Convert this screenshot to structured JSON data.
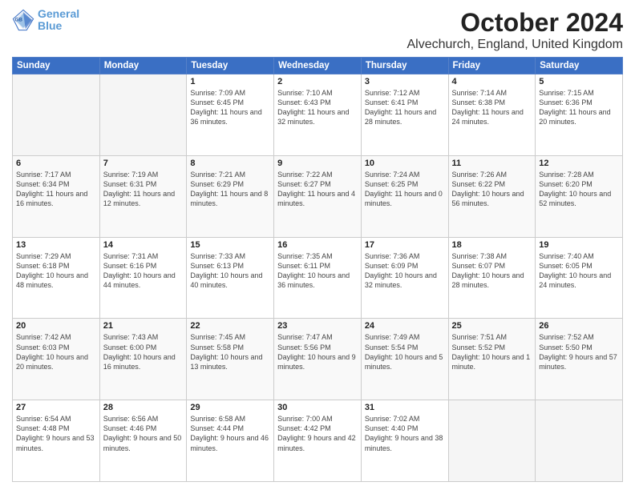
{
  "header": {
    "logo_line1": "General",
    "logo_line2": "Blue",
    "month": "October 2024",
    "location": "Alvechurch, England, United Kingdom"
  },
  "weekdays": [
    "Sunday",
    "Monday",
    "Tuesday",
    "Wednesday",
    "Thursday",
    "Friday",
    "Saturday"
  ],
  "weeks": [
    [
      {
        "day": "",
        "sunrise": "",
        "sunset": "",
        "daylight": "",
        "empty": true
      },
      {
        "day": "",
        "sunrise": "",
        "sunset": "",
        "daylight": "",
        "empty": true
      },
      {
        "day": "1",
        "sunrise": "Sunrise: 7:09 AM",
        "sunset": "Sunset: 6:45 PM",
        "daylight": "Daylight: 11 hours and 36 minutes."
      },
      {
        "day": "2",
        "sunrise": "Sunrise: 7:10 AM",
        "sunset": "Sunset: 6:43 PM",
        "daylight": "Daylight: 11 hours and 32 minutes."
      },
      {
        "day": "3",
        "sunrise": "Sunrise: 7:12 AM",
        "sunset": "Sunset: 6:41 PM",
        "daylight": "Daylight: 11 hours and 28 minutes."
      },
      {
        "day": "4",
        "sunrise": "Sunrise: 7:14 AM",
        "sunset": "Sunset: 6:38 PM",
        "daylight": "Daylight: 11 hours and 24 minutes."
      },
      {
        "day": "5",
        "sunrise": "Sunrise: 7:15 AM",
        "sunset": "Sunset: 6:36 PM",
        "daylight": "Daylight: 11 hours and 20 minutes."
      }
    ],
    [
      {
        "day": "6",
        "sunrise": "Sunrise: 7:17 AM",
        "sunset": "Sunset: 6:34 PM",
        "daylight": "Daylight: 11 hours and 16 minutes."
      },
      {
        "day": "7",
        "sunrise": "Sunrise: 7:19 AM",
        "sunset": "Sunset: 6:31 PM",
        "daylight": "Daylight: 11 hours and 12 minutes."
      },
      {
        "day": "8",
        "sunrise": "Sunrise: 7:21 AM",
        "sunset": "Sunset: 6:29 PM",
        "daylight": "Daylight: 11 hours and 8 minutes."
      },
      {
        "day": "9",
        "sunrise": "Sunrise: 7:22 AM",
        "sunset": "Sunset: 6:27 PM",
        "daylight": "Daylight: 11 hours and 4 minutes."
      },
      {
        "day": "10",
        "sunrise": "Sunrise: 7:24 AM",
        "sunset": "Sunset: 6:25 PM",
        "daylight": "Daylight: 11 hours and 0 minutes."
      },
      {
        "day": "11",
        "sunrise": "Sunrise: 7:26 AM",
        "sunset": "Sunset: 6:22 PM",
        "daylight": "Daylight: 10 hours and 56 minutes."
      },
      {
        "day": "12",
        "sunrise": "Sunrise: 7:28 AM",
        "sunset": "Sunset: 6:20 PM",
        "daylight": "Daylight: 10 hours and 52 minutes."
      }
    ],
    [
      {
        "day": "13",
        "sunrise": "Sunrise: 7:29 AM",
        "sunset": "Sunset: 6:18 PM",
        "daylight": "Daylight: 10 hours and 48 minutes."
      },
      {
        "day": "14",
        "sunrise": "Sunrise: 7:31 AM",
        "sunset": "Sunset: 6:16 PM",
        "daylight": "Daylight: 10 hours and 44 minutes."
      },
      {
        "day": "15",
        "sunrise": "Sunrise: 7:33 AM",
        "sunset": "Sunset: 6:13 PM",
        "daylight": "Daylight: 10 hours and 40 minutes."
      },
      {
        "day": "16",
        "sunrise": "Sunrise: 7:35 AM",
        "sunset": "Sunset: 6:11 PM",
        "daylight": "Daylight: 10 hours and 36 minutes."
      },
      {
        "day": "17",
        "sunrise": "Sunrise: 7:36 AM",
        "sunset": "Sunset: 6:09 PM",
        "daylight": "Daylight: 10 hours and 32 minutes."
      },
      {
        "day": "18",
        "sunrise": "Sunrise: 7:38 AM",
        "sunset": "Sunset: 6:07 PM",
        "daylight": "Daylight: 10 hours and 28 minutes."
      },
      {
        "day": "19",
        "sunrise": "Sunrise: 7:40 AM",
        "sunset": "Sunset: 6:05 PM",
        "daylight": "Daylight: 10 hours and 24 minutes."
      }
    ],
    [
      {
        "day": "20",
        "sunrise": "Sunrise: 7:42 AM",
        "sunset": "Sunset: 6:03 PM",
        "daylight": "Daylight: 10 hours and 20 minutes."
      },
      {
        "day": "21",
        "sunrise": "Sunrise: 7:43 AM",
        "sunset": "Sunset: 6:00 PM",
        "daylight": "Daylight: 10 hours and 16 minutes."
      },
      {
        "day": "22",
        "sunrise": "Sunrise: 7:45 AM",
        "sunset": "Sunset: 5:58 PM",
        "daylight": "Daylight: 10 hours and 13 minutes."
      },
      {
        "day": "23",
        "sunrise": "Sunrise: 7:47 AM",
        "sunset": "Sunset: 5:56 PM",
        "daylight": "Daylight: 10 hours and 9 minutes."
      },
      {
        "day": "24",
        "sunrise": "Sunrise: 7:49 AM",
        "sunset": "Sunset: 5:54 PM",
        "daylight": "Daylight: 10 hours and 5 minutes."
      },
      {
        "day": "25",
        "sunrise": "Sunrise: 7:51 AM",
        "sunset": "Sunset: 5:52 PM",
        "daylight": "Daylight: 10 hours and 1 minute."
      },
      {
        "day": "26",
        "sunrise": "Sunrise: 7:52 AM",
        "sunset": "Sunset: 5:50 PM",
        "daylight": "Daylight: 9 hours and 57 minutes."
      }
    ],
    [
      {
        "day": "27",
        "sunrise": "Sunrise: 6:54 AM",
        "sunset": "Sunset: 4:48 PM",
        "daylight": "Daylight: 9 hours and 53 minutes."
      },
      {
        "day": "28",
        "sunrise": "Sunrise: 6:56 AM",
        "sunset": "Sunset: 4:46 PM",
        "daylight": "Daylight: 9 hours and 50 minutes."
      },
      {
        "day": "29",
        "sunrise": "Sunrise: 6:58 AM",
        "sunset": "Sunset: 4:44 PM",
        "daylight": "Daylight: 9 hours and 46 minutes."
      },
      {
        "day": "30",
        "sunrise": "Sunrise: 7:00 AM",
        "sunset": "Sunset: 4:42 PM",
        "daylight": "Daylight: 9 hours and 42 minutes."
      },
      {
        "day": "31",
        "sunrise": "Sunrise: 7:02 AM",
        "sunset": "Sunset: 4:40 PM",
        "daylight": "Daylight: 9 hours and 38 minutes."
      },
      {
        "day": "",
        "sunrise": "",
        "sunset": "",
        "daylight": "",
        "empty": true
      },
      {
        "day": "",
        "sunrise": "",
        "sunset": "",
        "daylight": "",
        "empty": true
      }
    ]
  ]
}
